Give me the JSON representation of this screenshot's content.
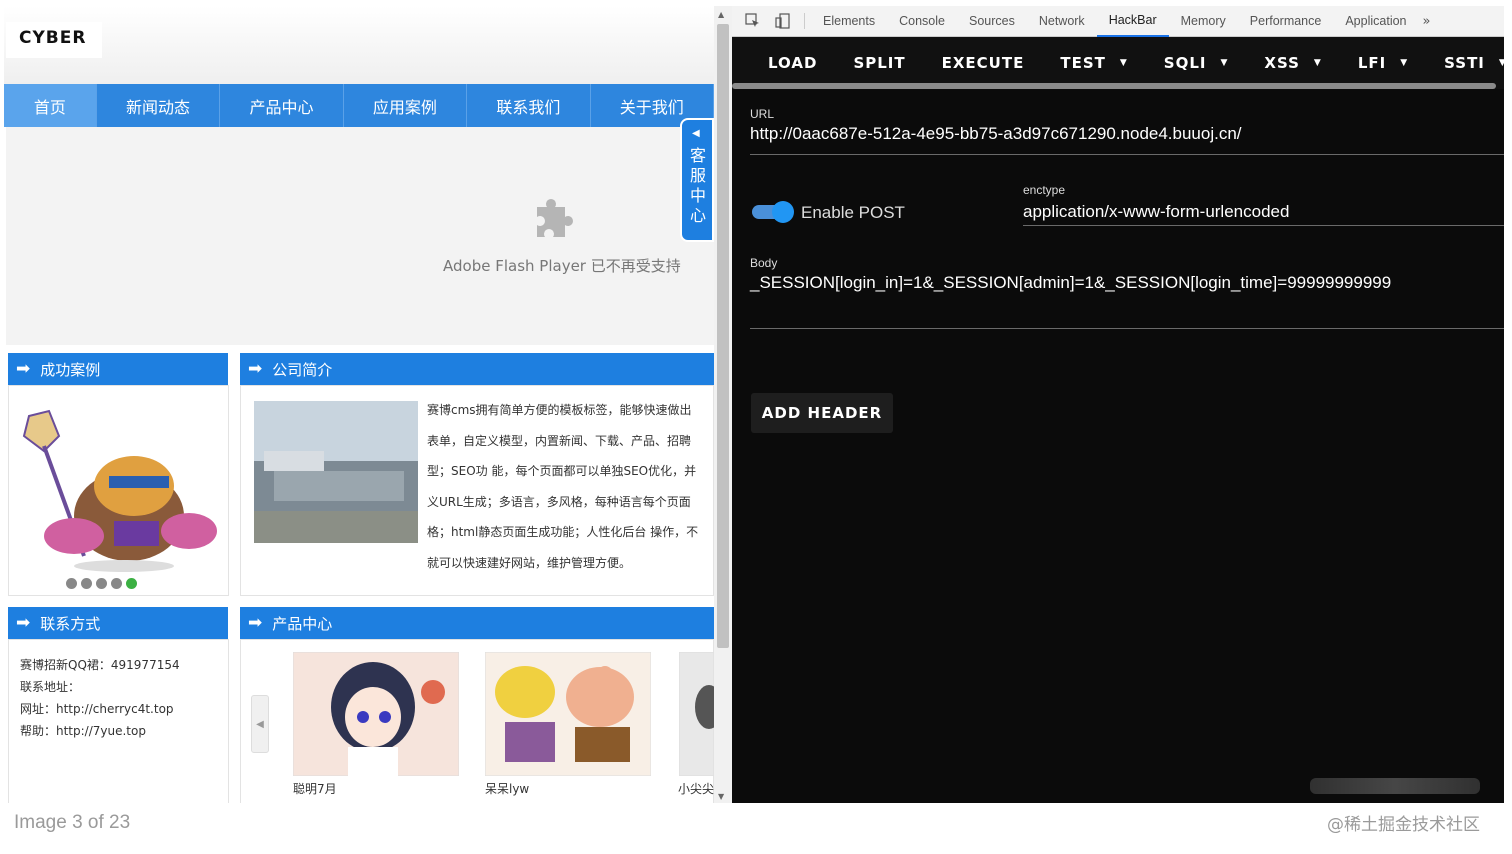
{
  "site": {
    "logo": "CYBER",
    "nav": [
      "首页",
      "新闻动态",
      "产品中心",
      "应用案例",
      "联系我们",
      "关于我们"
    ],
    "flash_text": "Adobe Flash Player 已不再受支持",
    "kefu_label": "客服中心",
    "cases_title": "成功案例",
    "intro_title": "公司简介",
    "intro_lines": [
      "赛博cms拥有简单方便的模板标签，能够快速做出",
      "表单，自定义模型，内置新闻、下载、产品、招聘",
      "型；SEO功 能，每个页面都可以单独SEO优化，并",
      "义URL生成；多语言，多风格，每种语言每个页面",
      "格；html静态页面生成功能；人性化后台 操作，不",
      "就可以快速建好网站，维护管理方便。"
    ],
    "contact_title": "联系方式",
    "contact_lines": [
      "赛博招新QQ裙：491977154",
      "联系地址：",
      "网址：http://cherryc4t.top",
      "帮助：http://7yue.top"
    ],
    "products_title": "产品中心",
    "products": [
      "聪明7月",
      "呆呆lyw",
      "小尖尖"
    ]
  },
  "devtools": {
    "tabs": [
      "Elements",
      "Console",
      "Sources",
      "Network",
      "HackBar",
      "Memory",
      "Performance",
      "Application"
    ],
    "active_tab": "HackBar",
    "more": "»"
  },
  "hackbar": {
    "toolbar": [
      {
        "label": "LOAD",
        "dropdown": false
      },
      {
        "label": "SPLIT",
        "dropdown": false
      },
      {
        "label": "EXECUTE",
        "dropdown": false
      },
      {
        "label": "TEST",
        "dropdown": true
      },
      {
        "label": "SQLI",
        "dropdown": true
      },
      {
        "label": "XSS",
        "dropdown": true
      },
      {
        "label": "LFI",
        "dropdown": true
      },
      {
        "label": "SSTI",
        "dropdown": true
      }
    ],
    "url_label": "URL",
    "url_value": "http://0aac687e-512a-4e95-bb75-a3d97c671290.node4.buuoj.cn/",
    "enable_post_label": "Enable POST",
    "enable_post": true,
    "enctype_label": "enctype",
    "enctype_value": "application/x-www-form-urlencoded",
    "body_label": "Body",
    "body_value": "_SESSION[login_in]=1&_SESSION[admin]=1&_SESSION[login_time]=99999999999",
    "add_header_label": "ADD HEADER"
  },
  "footer": {
    "image_counter": "Image 3 of 23",
    "watermark": "@稀土掘金技术社区"
  },
  "colors": {
    "site_blue": "#1e7fe0",
    "nav_active": "#5aa4ec",
    "toggle_on": "#2196f3",
    "devtools_bg": "#0b0b0b"
  }
}
